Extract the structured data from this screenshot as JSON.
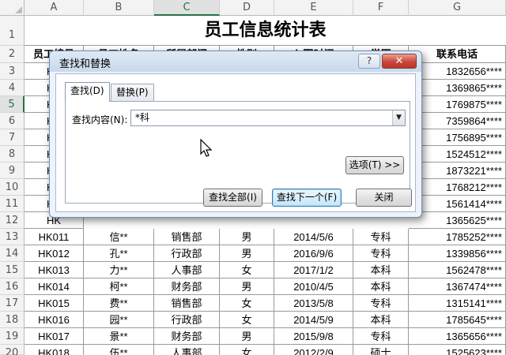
{
  "columns": [
    "A",
    "B",
    "C",
    "D",
    "E",
    "F",
    "G"
  ],
  "active_column": "C",
  "active_row": "5",
  "row_numbers": [
    "1",
    "2",
    "3",
    "4",
    "5",
    "6",
    "7",
    "8",
    "9",
    "10",
    "11",
    "12",
    "13",
    "14",
    "15",
    "16",
    "17",
    "18",
    "19",
    "20"
  ],
  "title": "员工信息统计表",
  "header_row_visible": [
    "员工编号",
    "员工姓名",
    "所属部门",
    "性别",
    "入职时间",
    "学历",
    "联系电话"
  ],
  "hidden_rows": [
    {
      "code": "HK",
      "phone": "1832656****"
    },
    {
      "code": "HK",
      "phone": "1369865****"
    },
    {
      "code": "HK",
      "phone": "1769875****"
    },
    {
      "code": "HK",
      "phone": "7359864****"
    },
    {
      "code": "HK",
      "phone": "1756895****"
    },
    {
      "code": "HK",
      "phone": "1524512****"
    },
    {
      "code": "HK",
      "phone": "1873221****"
    },
    {
      "code": "HK",
      "phone": "1768212****"
    },
    {
      "code": "HK",
      "phone": "1561414****"
    },
    {
      "code": "HK",
      "phone": "1365625****"
    }
  ],
  "rows": [
    [
      "HK011",
      "信**",
      "销售部",
      "男",
      "2014/5/6",
      "专科",
      "1785252****"
    ],
    [
      "HK012",
      "孔**",
      "行政部",
      "男",
      "2016/9/6",
      "专科",
      "1339856****"
    ],
    [
      "HK013",
      "力**",
      "人事部",
      "女",
      "2017/1/2",
      "本科",
      "1562478****"
    ],
    [
      "HK014",
      "柯**",
      "财务部",
      "男",
      "2010/4/5",
      "本科",
      "1367474****"
    ],
    [
      "HK015",
      "费**",
      "销售部",
      "女",
      "2013/5/8",
      "专科",
      "1315141****"
    ],
    [
      "HK016",
      "园**",
      "行政部",
      "女",
      "2014/5/9",
      "本科",
      "1785645****"
    ],
    [
      "HK017",
      "景**",
      "财务部",
      "男",
      "2015/9/8",
      "专科",
      "1365656****"
    ],
    [
      "HK018",
      "伍**",
      "人事部",
      "女",
      "2012/2/9",
      "硕士",
      "1525623****"
    ]
  ],
  "dialog": {
    "title": "查找和替换",
    "help_label": "?",
    "close_label": "✕",
    "tab_find": "查找(D)",
    "tab_replace": "替换(P)",
    "find_label": "查找内容(N):",
    "find_value": "*科",
    "options_button": "选项(T) >>",
    "find_all_button": "查找全部(I)",
    "find_next_button": "查找下一个(F)",
    "close_button": "关闭"
  }
}
